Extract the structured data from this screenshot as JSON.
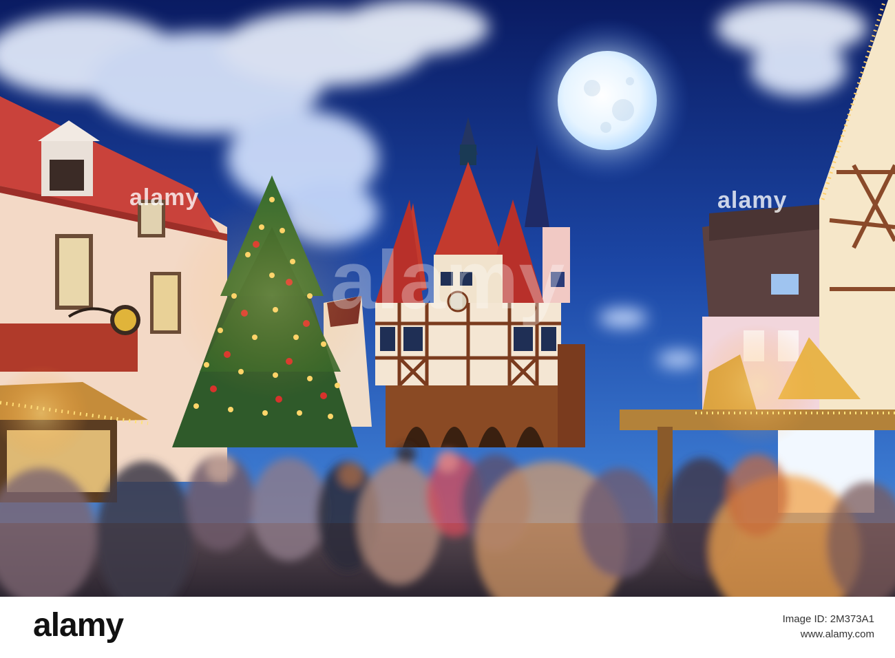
{
  "watermark": {
    "center_brand": "alamy",
    "left_brand": "alamy",
    "right_brand": "alamy"
  },
  "footer": {
    "brand": "alamy",
    "image_id_line": "Image ID: 2M373A1",
    "url_line": "www.alamy.com"
  },
  "colors": {
    "sky_top": "#0b1f6b",
    "sky_mid": "#1f4fb0",
    "moon": "#eaf6ff",
    "roof_red": "#c1272d",
    "timber": "#7a3b1e",
    "tree_green": "#2f5a2a",
    "light_gold": "#ffd36a"
  }
}
